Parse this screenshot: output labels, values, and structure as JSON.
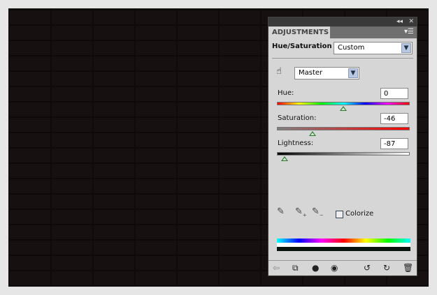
{
  "panel": {
    "title": "ADJUSTMENTS",
    "adjustment_name": "Hue/Saturation",
    "preset": "Custom",
    "channel": "Master",
    "hue": {
      "label": "Hue:",
      "value": "0"
    },
    "saturation": {
      "label": "Saturation:",
      "value": "-46"
    },
    "lightness": {
      "label": "Lightness:",
      "value": "-87"
    },
    "colorize": {
      "label": "Colorize",
      "checked": false
    }
  },
  "icons": [
    "collapse-icon",
    "close-icon",
    "panel-menu-icon",
    "targeted-adjustment-icon",
    "eyedropper-icon",
    "eyedropper-plus-icon",
    "eyedropper-minus-icon",
    "back-arrow-icon",
    "expand-view-icon",
    "clip-layer-icon",
    "visibility-eye-icon",
    "view-previous-icon",
    "reset-icon",
    "trash-icon"
  ]
}
